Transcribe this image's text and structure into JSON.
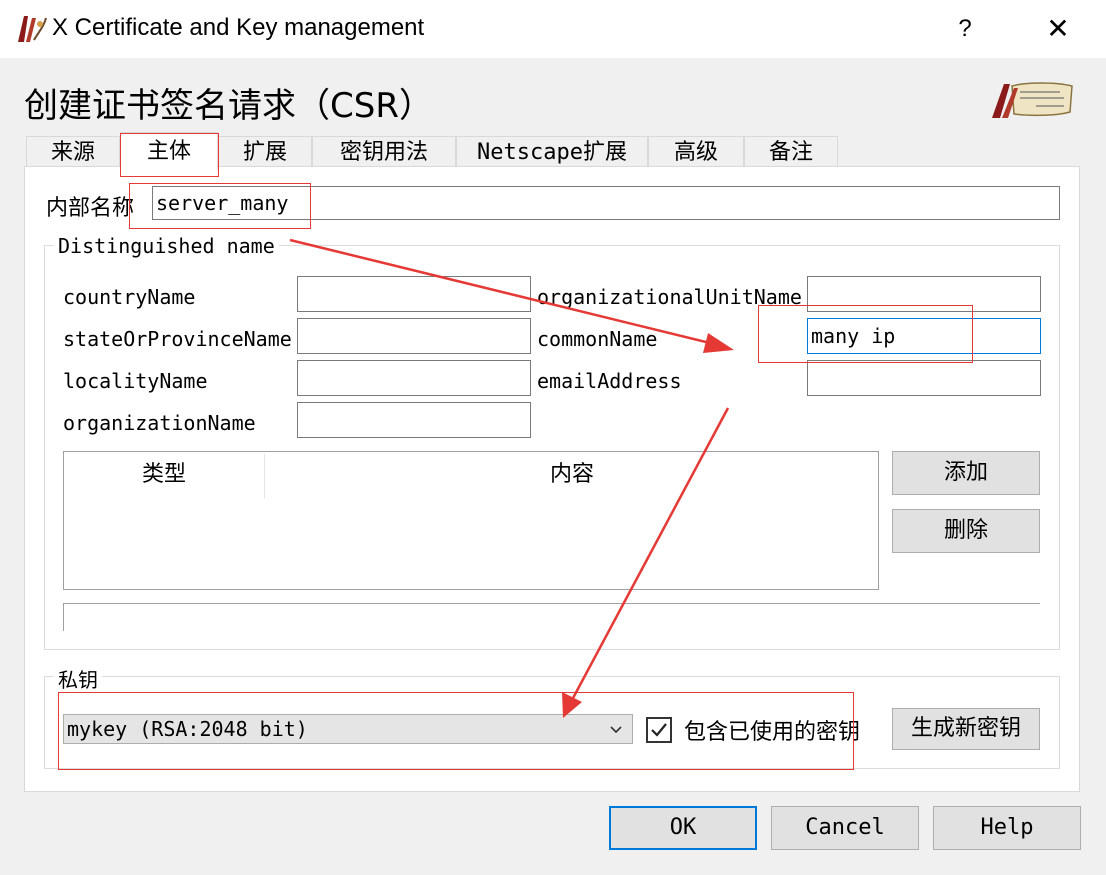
{
  "window": {
    "title": "X Certificate and Key management",
    "help_glyph": "?",
    "close_glyph": "✕"
  },
  "dialog": {
    "heading": "创建证书签名请求（CSR）"
  },
  "tabs": [
    {
      "label": "来源",
      "active": false
    },
    {
      "label": "主体",
      "active": true
    },
    {
      "label": "扩展",
      "active": false
    },
    {
      "label": "密钥用法",
      "active": false
    },
    {
      "label": "Netscape扩展",
      "active": false
    },
    {
      "label": "高级",
      "active": false
    },
    {
      "label": "备注",
      "active": false
    }
  ],
  "subject": {
    "internal_name_label": "内部名称",
    "internal_name_value": "server_many",
    "dn_group_title": "Distinguished name",
    "fields": {
      "countryName": {
        "label": "countryName",
        "value": ""
      },
      "stateOrProvinceName": {
        "label": "stateOrProvinceName",
        "value": ""
      },
      "localityName": {
        "label": "localityName",
        "value": ""
      },
      "organizationName": {
        "label": "organizationName",
        "value": ""
      },
      "organizationalUnitName": {
        "label": "organizationalUnitName",
        "value": ""
      },
      "commonName": {
        "label": "commonName",
        "value": "many ip"
      },
      "emailAddress": {
        "label": "emailAddress",
        "value": ""
      }
    },
    "table": {
      "columns": [
        "类型",
        "内容"
      ],
      "rows": []
    },
    "add_button": "添加",
    "delete_button": "删除"
  },
  "private_key": {
    "group_title": "私钥",
    "selected_key": "mykey (RSA:2048 bit)",
    "include_used_label": "包含已使用的密钥",
    "include_used_checked": true,
    "generate_button": "生成新密钥"
  },
  "footer": {
    "ok": "OK",
    "cancel": "Cancel",
    "help": "Help"
  },
  "colors": {
    "annotation": "#e53935",
    "focus": "#0078d7"
  },
  "icons": [
    "app-logo-icon",
    "certificate-scroll-icon",
    "chevron-down-icon",
    "checkmark-icon"
  ]
}
